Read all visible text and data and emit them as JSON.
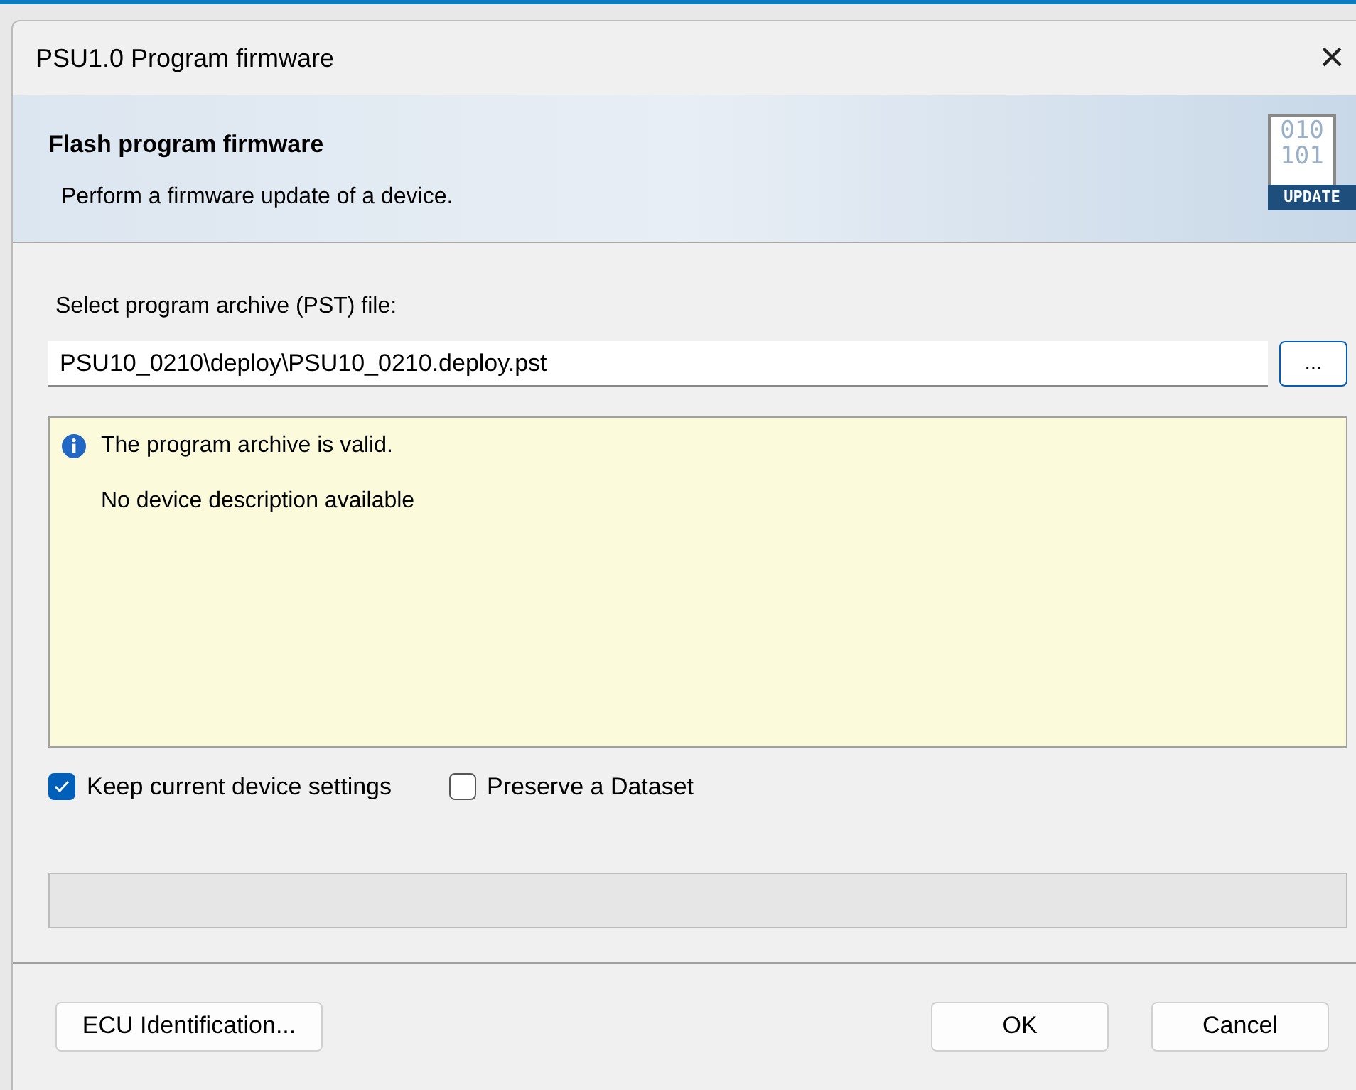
{
  "window": {
    "title": "PSU1.0 Program firmware",
    "close": "×"
  },
  "header": {
    "title": "Flash program firmware",
    "subtitle": "Perform a firmware update of a device.",
    "logo": {
      "lines": [
        "010",
        "101"
      ],
      "badge": "UPDATE"
    }
  },
  "file": {
    "label": "Select program archive (PST) file:",
    "value": "PSU10_0210\\deploy\\PSU10_0210.deploy.pst",
    "browse": "..."
  },
  "messages": [
    {
      "kind": "info",
      "text": "The program archive is valid."
    },
    {
      "kind": "plain",
      "text": "No device description available"
    }
  ],
  "options": [
    {
      "label": "Keep current device settings",
      "checked": true
    },
    {
      "label": "Preserve a Dataset",
      "checked": false
    }
  ],
  "progress": {
    "level": 0
  },
  "buttons": [
    {
      "label": "ECU Identification...",
      "kind": "left"
    },
    {
      "label": "OK",
      "kind": "right"
    },
    {
      "label": "Cancel",
      "kind": "right"
    }
  ]
}
